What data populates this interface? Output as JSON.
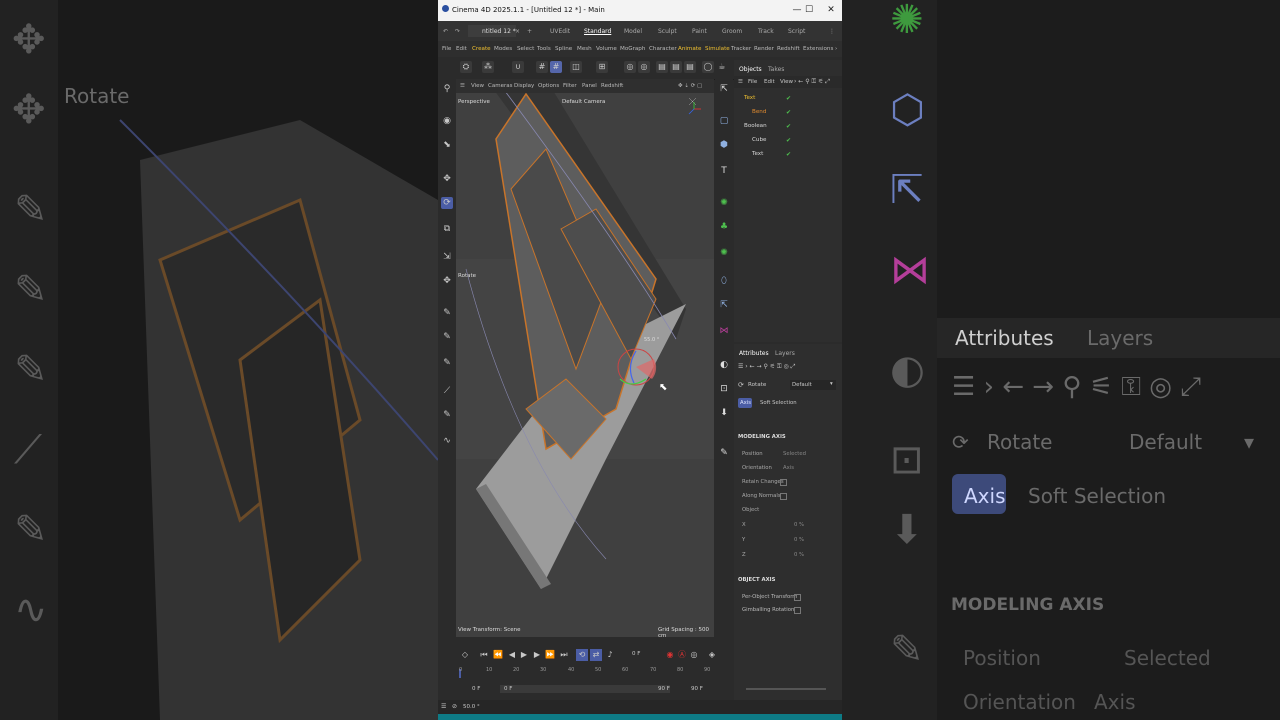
{
  "window": {
    "title": "Cinema 4D 2025.1.1 - [Untitled 12 *] - Main",
    "minimize": "—",
    "maximize": "☐",
    "close": "✕"
  },
  "doc_tab": "ntitled 12 *",
  "layouts": [
    "UVEdit",
    "Standard",
    "Model",
    "Sculpt",
    "Paint",
    "Groom",
    "Track",
    "Script"
  ],
  "menu": [
    "File",
    "Edit",
    "Create",
    "Modes",
    "Select",
    "Tools",
    "Spline",
    "Mesh",
    "Volume",
    "MoGraph",
    "Character",
    "Animate",
    "Simulate",
    "Tracker",
    "Render",
    "Redshift",
    "Extensions"
  ],
  "viewport": {
    "menu": [
      "View",
      "Cameras",
      "Display",
      "Options",
      "Filter",
      "Panel",
      "Redshift"
    ],
    "perspective": "Perspective",
    "camera": "Default Camera",
    "tool_label": "Rotate",
    "angle": "55.0 °",
    "transform": "View Transform: Scene",
    "grid": "Grid Spacing : 500 cm"
  },
  "objects_panel": {
    "tabs": [
      "Objects",
      "Takes"
    ],
    "menu": [
      "File",
      "Edit",
      "View"
    ],
    "items": [
      {
        "name": "Text",
        "color": "#f0c030"
      },
      {
        "name": "Bend",
        "color": "#e08a30"
      },
      {
        "name": "Boolean",
        "color": "#d8d8d8"
      },
      {
        "name": "Cube",
        "color": "#d8d8d8"
      },
      {
        "name": "Text",
        "color": "#d8d8d8"
      }
    ]
  },
  "attributes_panel": {
    "tabs": [
      "Attributes",
      "Layers"
    ],
    "tool": "Rotate",
    "preset": "Default",
    "subtabs": [
      "Axis",
      "Soft Selection"
    ],
    "modeling_axis": "MODELING AXIS",
    "rows": [
      {
        "label": "Position",
        "value": "Selected"
      },
      {
        "label": "Orientation",
        "value": "Axis"
      },
      {
        "label": "Retain Changes",
        "value": ""
      },
      {
        "label": "Along Normals",
        "value": ""
      },
      {
        "label": "Object",
        "value": ""
      }
    ],
    "xyz": [
      {
        "label": "X",
        "value": "0 %"
      },
      {
        "label": "Y",
        "value": "0 %"
      },
      {
        "label": "Z",
        "value": "0 %"
      }
    ],
    "object_axis": "OBJECT AXIS",
    "per_object": "Per-Object Transform",
    "gimballing": "Gimballing Rotation"
  },
  "timeline": {
    "current_frame": "0 F",
    "ticks": [
      "0",
      "10",
      "20",
      "30",
      "40",
      "50",
      "60",
      "70",
      "80",
      "90"
    ],
    "start": "0 F",
    "range_start": "0 F",
    "range_end": "90 F",
    "end": "90 F"
  },
  "status": "50.0 °",
  "background": {
    "left_label": "Rotate",
    "right_tabs": [
      "Attributes",
      "Layers"
    ],
    "right_tool": "Rotate",
    "right_preset": "Default",
    "right_subtabs": [
      "Axis",
      "Soft Selection"
    ],
    "right_heading": "MODELING AXIS",
    "right_rows": [
      "Position",
      "Orientation"
    ],
    "right_values": [
      "Selected",
      "Axis"
    ]
  },
  "colors": {
    "accent": "#4b5da5",
    "orange_edges": "#d07a2a",
    "teal_bar": "#0e7b86"
  }
}
